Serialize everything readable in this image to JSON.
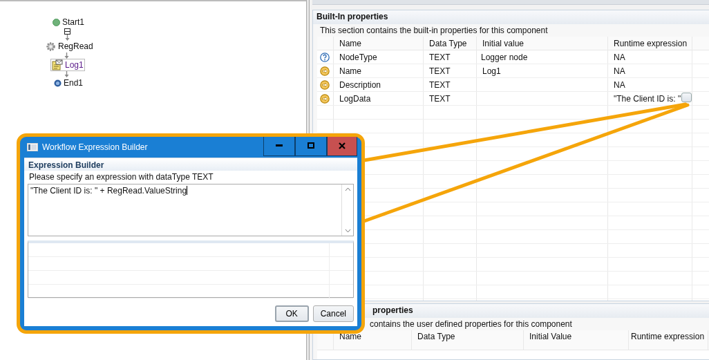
{
  "diagram": {
    "nodes": [
      {
        "label": "Start1",
        "kind": "start",
        "selected": false
      },
      {
        "label": "RegRead",
        "kind": "task",
        "selected": false
      },
      {
        "label": "Log1",
        "kind": "log",
        "selected": true
      },
      {
        "label": "End1",
        "kind": "end",
        "selected": false
      }
    ]
  },
  "builtin_properties": {
    "title": "Built-In properties",
    "description": "This section contains the built-in properties for this component",
    "columns": [
      "Name",
      "Data Type",
      "Initial value",
      "Runtime expression"
    ],
    "rows": [
      {
        "kind": "info",
        "cells": [
          "NodeType",
          "TEXT",
          "Logger node",
          "NA"
        ]
      },
      {
        "kind": "editable",
        "cells": [
          "Name",
          "TEXT",
          "Log1",
          "NA"
        ]
      },
      {
        "kind": "editable",
        "cells": [
          "Description",
          "TEXT",
          "",
          "NA"
        ]
      },
      {
        "kind": "expression",
        "cells": [
          "LogData",
          "TEXT",
          "",
          "\"The Client ID is: \""
        ]
      }
    ]
  },
  "user_properties": {
    "title": "properties",
    "description": "contains the user defined properties for this component",
    "columns": [
      "Name",
      "Data Type",
      "Initial Value",
      "Runtime expression"
    ]
  },
  "dialog": {
    "title": "Workflow Expression Builder",
    "heading": "Expression Builder",
    "prompt": "Please specify an expression with dataType TEXT",
    "expression": "\"The Client ID is: \" + RegRead.ValueString",
    "buttons": [
      "OK",
      "Cancel"
    ]
  }
}
